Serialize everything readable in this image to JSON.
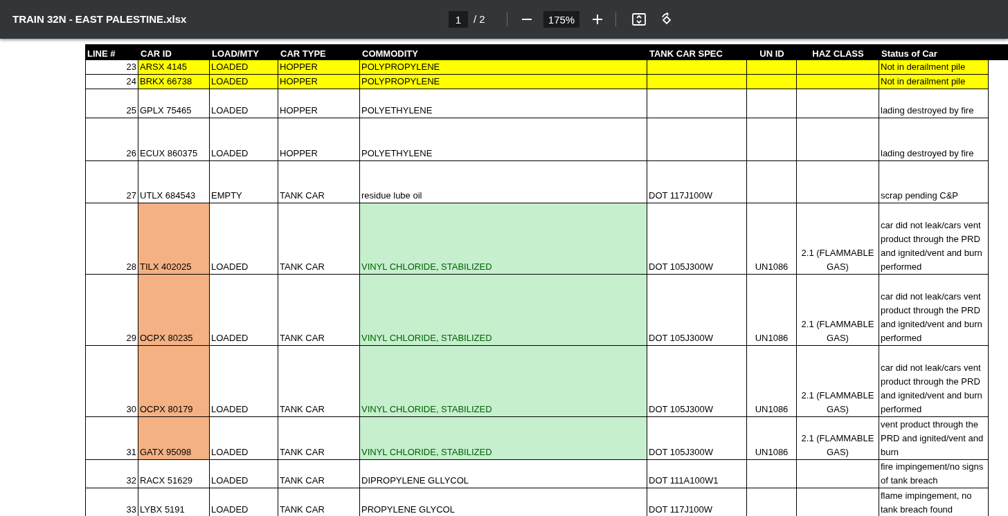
{
  "toolbar": {
    "title": "TRAIN 32N - EAST PALESTINE.xlsx",
    "page": "1",
    "page_total": "/ 2",
    "zoom": "175%"
  },
  "table": {
    "columns": [
      "LINE #",
      "CAR ID",
      "LOAD/MTY",
      "CAR TYPE",
      "COMMODITY",
      "TANK CAR SPEC",
      "UN ID",
      "HAZ CLASS",
      "Status of Car"
    ],
    "rows": [
      {
        "kind": "yellow",
        "cells": [
          "23",
          "ARSX 4145",
          "LOADED",
          "HOPPER",
          "POLYPROPYLENE",
          "",
          "",
          "",
          "Not in derailment pile"
        ]
      },
      {
        "kind": "yellow",
        "cells": [
          "24",
          "BRKX 66738",
          "LOADED",
          "HOPPER",
          "POLYPROPYLENE",
          "",
          "",
          "",
          "Not in derailment pile"
        ]
      },
      {
        "kind": "plain",
        "cells": [
          "25",
          "GPLX 75465",
          "LOADED",
          "HOPPER",
          "POLYETHYLENE",
          "",
          "",
          "",
          "lading destroyed by fire"
        ]
      },
      {
        "kind": "plain",
        "cells": [
          "26",
          "ECUX 860375",
          "LOADED",
          "HOPPER",
          "POLYETHYLENE",
          "",
          "",
          "",
          "lading destroyed by fire"
        ]
      },
      {
        "kind": "plain",
        "cells": [
          "27",
          "UTLX 684543",
          "EMPTY",
          "TANK CAR",
          "residue lube oil",
          "DOT 117J100W",
          "",
          "",
          "scrap pending C&P"
        ]
      },
      {
        "kind": "hazmat",
        "cells": [
          "28",
          "TILX 402025",
          "LOADED",
          "TANK CAR",
          "VINYL CHLORIDE, STABILIZED",
          "DOT 105J300W",
          "UN1086",
          "2.1 (FLAMMABLE GAS)",
          "car did not leak/cars vent product through the PRD and ignited/vent and burn performed"
        ]
      },
      {
        "kind": "hazmat",
        "cells": [
          "29",
          "OCPX 80235",
          "LOADED",
          "TANK CAR",
          "VINYL CHLORIDE, STABILIZED",
          "DOT 105J300W",
          "UN1086",
          "2.1 (FLAMMABLE GAS)",
          "car did not leak/cars vent product through the PRD and ignited/vent and burn performed"
        ]
      },
      {
        "kind": "hazmat",
        "cells": [
          "30",
          "OCPX 80179",
          "LOADED",
          "TANK CAR",
          "VINYL CHLORIDE, STABILIZED",
          "DOT 105J300W",
          "UN1086",
          "2.1 (FLAMMABLE GAS)",
          "car did not leak/cars vent product through the PRD and ignited/vent and burn performed"
        ]
      },
      {
        "kind": "hazmat",
        "cells": [
          "31",
          "GATX 95098",
          "LOADED",
          "TANK CAR",
          "VINYL CHLORIDE, STABILIZED",
          "DOT 105J300W",
          "UN1086",
          "2.1 (FLAMMABLE GAS)",
          "vent product through the PRD and ignited/vent and burn"
        ]
      },
      {
        "kind": "plain",
        "cells": [
          "32",
          "RACX 51629",
          "LOADED",
          "TANK CAR",
          "DIPROPYLENE GLLYCOL",
          "DOT 111A100W1",
          "",
          "",
          "fire impingement/no signs of tank breach"
        ]
      },
      {
        "kind": "plain",
        "cells": [
          "33",
          "LYBX 5191",
          "LOADED",
          "TANK CAR",
          "PROPYLENE GLYCOL",
          "DOT 117J100W",
          "",
          "",
          "flame impingement, no tank breach found"
        ]
      }
    ]
  }
}
